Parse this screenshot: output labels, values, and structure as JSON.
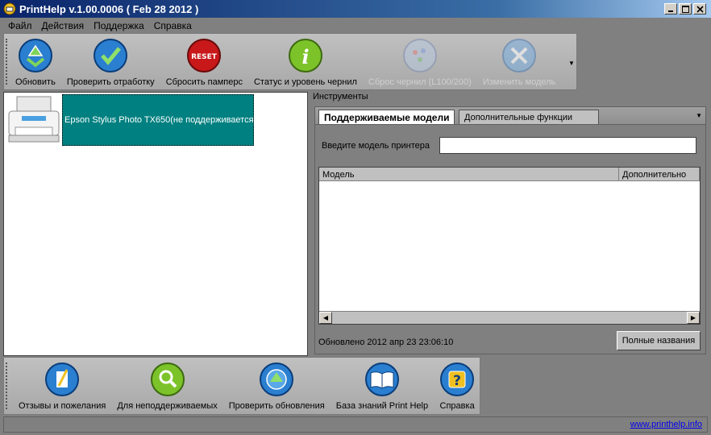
{
  "window": {
    "title": "PrintHelp v.1.00.0006 ( Feb 28 2012 )"
  },
  "menu": [
    "Файл",
    "Действия",
    "Поддержка",
    "Справка"
  ],
  "toolbar_top": [
    {
      "label": "Обновить",
      "icon": "refresh-icon",
      "enabled": true
    },
    {
      "label": "Проверить отработку",
      "icon": "check-icon",
      "enabled": true
    },
    {
      "label": "Сбросить памперс",
      "icon": "reset-icon",
      "enabled": true
    },
    {
      "label": "Статус и уровень чернил",
      "icon": "info-icon",
      "enabled": true
    },
    {
      "label": "Сброс чернил (L100/200)",
      "icon": "ink-reset-icon",
      "enabled": false
    },
    {
      "label": "Изменить модель",
      "icon": "tools-icon",
      "enabled": false
    }
  ],
  "printer": {
    "name": "Epson Stylus Photo TX650(не поддерживается)"
  },
  "tools": {
    "title": "Инструменты",
    "tabs": [
      "Поддерживаемые модели",
      "Дополнительные функции"
    ],
    "model_label": "Введите модель принтера",
    "model_value": "",
    "columns": [
      "Модель",
      "Дополнительно"
    ],
    "updated": "Обновлено 2012 апр 23 23:06:10",
    "full_names_button": "Полные названия"
  },
  "toolbar_bottom": [
    {
      "label": "Отзывы и пожелания",
      "icon": "feedback-icon"
    },
    {
      "label": "Для неподдерживаемых",
      "icon": "search-icon"
    },
    {
      "label": "Проверить обновления",
      "icon": "update-icon"
    },
    {
      "label": "База знаний Print Help",
      "icon": "book-icon"
    },
    {
      "label": "Справка",
      "icon": "help-icon"
    }
  ],
  "status": {
    "link": "www.printhelp.info"
  }
}
